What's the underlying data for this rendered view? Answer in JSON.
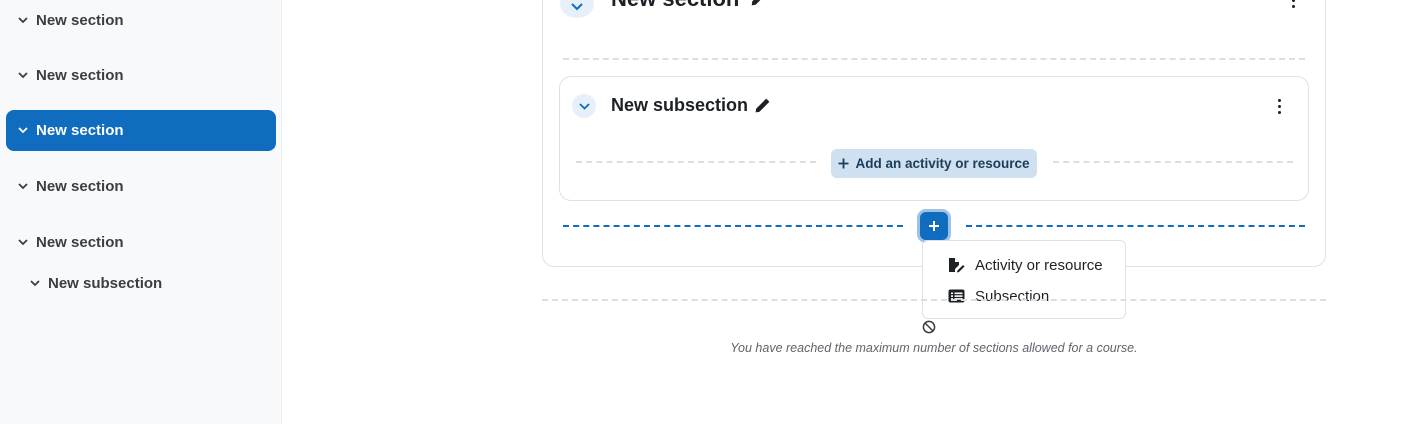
{
  "course_index": {
    "items": [
      {
        "label": "New section"
      },
      {
        "label": "New section"
      },
      {
        "label": "New section"
      },
      {
        "label": "New section"
      },
      {
        "label": "New section"
      },
      {
        "label": "New subsection"
      }
    ]
  },
  "section": {
    "title": "New section"
  },
  "subsection": {
    "title": "New subsection",
    "add_activity_label": "Add an activity or resource"
  },
  "add_menu": {
    "items": [
      {
        "label": "Activity or resource",
        "icon": "file-pen-icon"
      },
      {
        "label": "Subsection",
        "icon": "list-icon"
      }
    ]
  },
  "limit_message": "You have reached the maximum number of sections allowed for a course.",
  "colors": {
    "accent": "#0f6cbf",
    "drawer_bg": "#f8f9fa",
    "add_activity_bg": "#cfe0f0"
  }
}
